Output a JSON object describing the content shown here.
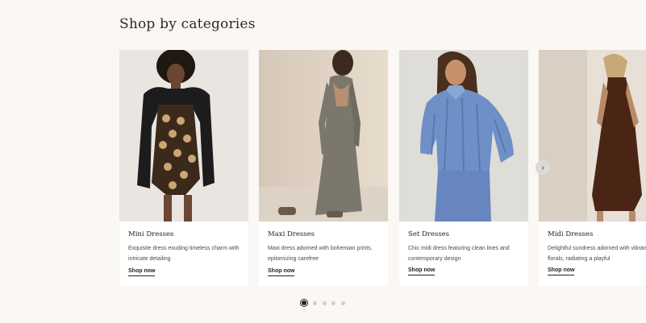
{
  "section": {
    "title": "Shop by categories"
  },
  "categories": [
    {
      "name": "Mini Dresses",
      "description": "Exquisite dress exuding timeless charm with intricate detailing",
      "cta": "Shop now"
    },
    {
      "name": "Maxi Dresses",
      "description": "Maxi dress adorned with bohemian prints, epitomizing carefree",
      "cta": "Shop now"
    },
    {
      "name": "Set Dresses",
      "description": "Chic midi dress featuring clean lines and contemporary design",
      "cta": "Shop now"
    },
    {
      "name": "Midi Dresses",
      "description": "Delightful sundress adorned with vibrant florals, radiating a playful",
      "cta": "Shop now"
    }
  ],
  "carousel": {
    "next_icon": "chevron-right-icon",
    "next_glyph": "›",
    "pages": 5,
    "active_page": 1
  },
  "colors": {
    "background": "#faf7f4",
    "card": "#ffffff",
    "active_dot": "#222222",
    "inactive_dot": "#cfcfcf"
  }
}
